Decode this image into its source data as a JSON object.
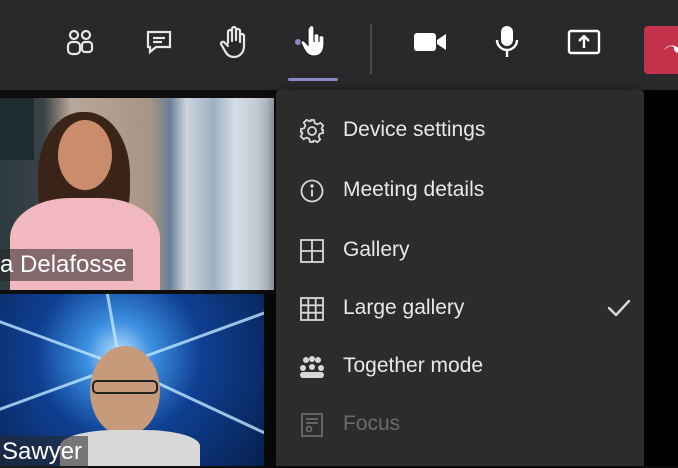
{
  "toolbar": {
    "buttons": [
      {
        "name": "participants-icon",
        "icon": "people-icon"
      },
      {
        "name": "chat-icon",
        "icon": "chat-bubble-icon"
      },
      {
        "name": "raise-hand-icon",
        "icon": "hand-icon"
      },
      {
        "name": "more-actions-icon",
        "icon": "ellipsis-icon"
      },
      {
        "name": "camera-icon",
        "icon": "video-camera-icon"
      },
      {
        "name": "mic-icon",
        "icon": "microphone-icon"
      },
      {
        "name": "share-icon",
        "icon": "share-tray-icon"
      },
      {
        "name": "hang-up-icon",
        "icon": "phone-icon"
      }
    ],
    "accent": "#8b8cc7",
    "hangup_color": "#c4314b"
  },
  "tiles": [
    {
      "name_label": "a Delafosse"
    },
    {
      "name_label": "Sawyer"
    }
  ],
  "menu": {
    "items": [
      {
        "label": "Device settings",
        "icon": "gear-icon",
        "enabled": true,
        "checked": false
      },
      {
        "label": "Meeting details",
        "icon": "info-icon",
        "enabled": true,
        "checked": false
      },
      {
        "label": "Gallery",
        "icon": "grid-2x2-icon",
        "enabled": true,
        "checked": false
      },
      {
        "label": "Large gallery",
        "icon": "grid-3x3-icon",
        "enabled": true,
        "checked": true
      },
      {
        "label": "Together mode",
        "icon": "together-mode-icon",
        "enabled": true,
        "checked": false
      },
      {
        "label": "Focus",
        "icon": "focus-icon",
        "enabled": false,
        "checked": false
      }
    ]
  }
}
